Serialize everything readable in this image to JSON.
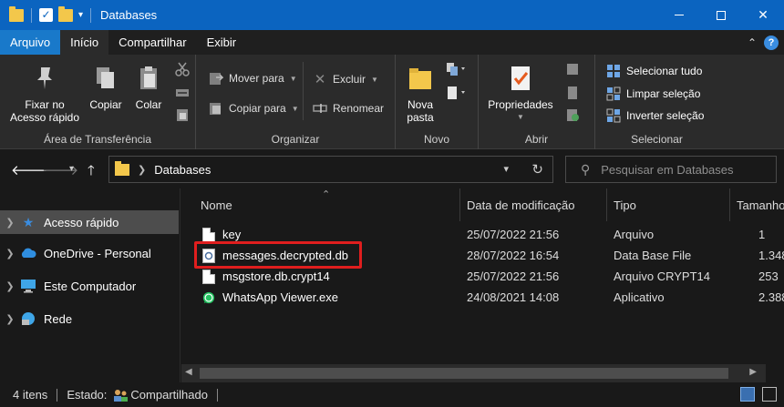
{
  "window": {
    "title": "Databases",
    "minimize_glyph": "—",
    "close_glyph": "✕"
  },
  "menu": {
    "tabs": [
      "Arquivo",
      "Início",
      "Compartilhar",
      "Exibir"
    ],
    "active_tab": "Início",
    "help_glyph": "?"
  },
  "ribbon": {
    "clipboard": {
      "label": "Área de Transferência",
      "pin_label": "Fixar no Acesso rápido",
      "copy_label": "Copiar",
      "paste_label": "Colar"
    },
    "organize": {
      "label": "Organizar",
      "move_to_label": "Mover para",
      "copy_to_label": "Copiar para",
      "delete_label": "Excluir",
      "rename_label": "Renomear"
    },
    "new": {
      "label": "Novo",
      "new_folder_label": "Nova pasta"
    },
    "open": {
      "label": "Abrir",
      "properties_label": "Propriedades"
    },
    "select": {
      "label": "Selecionar",
      "select_all_label": "Selecionar tudo",
      "select_none_label": "Limpar seleção",
      "invert_label": "Inverter seleção"
    }
  },
  "address": {
    "path": "Databases",
    "search_placeholder": "Pesquisar em Databases"
  },
  "nav_pane": {
    "items": [
      {
        "label": "Acesso rápido",
        "icon": "star-icon"
      },
      {
        "label": "OneDrive - Personal",
        "icon": "cloud-icon"
      },
      {
        "label": "Este Computador",
        "icon": "computer-icon"
      },
      {
        "label": "Rede",
        "icon": "network-icon"
      }
    ]
  },
  "file_list": {
    "columns": [
      "Nome",
      "Data de modificação",
      "Tipo",
      "Tamanho"
    ],
    "rows": [
      {
        "name": "key",
        "modified": "25/07/2022 21:56",
        "type": "Arquivo",
        "size": "1"
      },
      {
        "name": "messages.decrypted.db",
        "modified": "28/07/2022 16:54",
        "type": "Data Base File",
        "size": "1.348"
      },
      {
        "name": "msgstore.db.crypt14",
        "modified": "25/07/2022 21:56",
        "type": "Arquivo CRYPT14",
        "size": "253"
      },
      {
        "name": "WhatsApp Viewer.exe",
        "modified": "24/08/2021 14:08",
        "type": "Aplicativo",
        "size": "2.388"
      }
    ],
    "highlighted_row": "messages.decrypted.db"
  },
  "status": {
    "item_count": "4 itens",
    "state_label": "Estado:",
    "state_value": "Compartilhado"
  },
  "colors": {
    "title_bar": "#0b64c0",
    "file_tab": "#1979ca",
    "highlight_border": "#e01e1e",
    "background": "#191919",
    "ribbon": "#2b2b2b"
  }
}
